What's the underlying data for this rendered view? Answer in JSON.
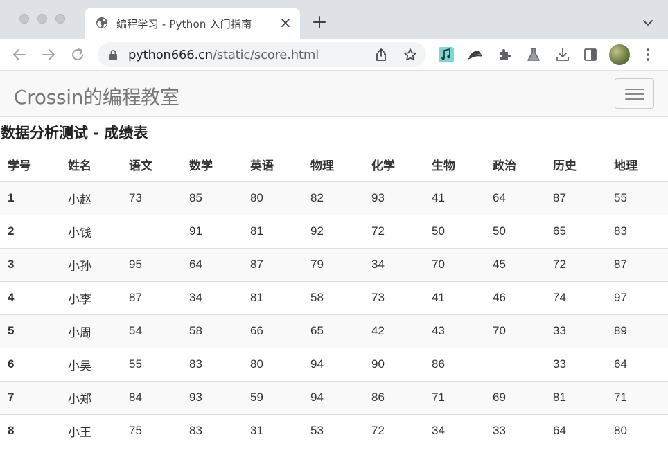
{
  "browser": {
    "tab_title": "编程学习 - Python 入门指南",
    "url_host": "python666.cn",
    "url_path": "/static/score.html"
  },
  "navbar": {
    "brand": "Crossin的编程教室"
  },
  "page": {
    "title": "数据分析测试 - 成绩表"
  },
  "table": {
    "headers": [
      "学号",
      "姓名",
      "语文",
      "数学",
      "英语",
      "物理",
      "化学",
      "生物",
      "政治",
      "历史",
      "地理"
    ],
    "rows": [
      [
        "1",
        "小赵",
        "73",
        "85",
        "80",
        "82",
        "93",
        "41",
        "64",
        "87",
        "55"
      ],
      [
        "2",
        "小钱",
        "",
        "91",
        "81",
        "92",
        "72",
        "50",
        "50",
        "65",
        "83"
      ],
      [
        "3",
        "小孙",
        "95",
        "64",
        "87",
        "79",
        "34",
        "70",
        "45",
        "72",
        "87"
      ],
      [
        "4",
        "小李",
        "87",
        "34",
        "81",
        "58",
        "73",
        "41",
        "46",
        "74",
        "97"
      ],
      [
        "5",
        "小周",
        "54",
        "58",
        "66",
        "65",
        "42",
        "43",
        "70",
        "33",
        "89"
      ],
      [
        "6",
        "小吴",
        "55",
        "83",
        "80",
        "94",
        "90",
        "86",
        "",
        "33",
        "64"
      ],
      [
        "7",
        "小郑",
        "84",
        "93",
        "59",
        "94",
        "86",
        "71",
        "69",
        "81",
        "71"
      ],
      [
        "8",
        "小王",
        "75",
        "83",
        "31",
        "53",
        "72",
        "34",
        "33",
        "64",
        "80"
      ]
    ]
  },
  "colors": {
    "tabbar_bg": "#dee1e6",
    "navbar_bg": "#f8f8f8",
    "brand_text": "#777777",
    "stripe_row": "#f9f9f9"
  }
}
